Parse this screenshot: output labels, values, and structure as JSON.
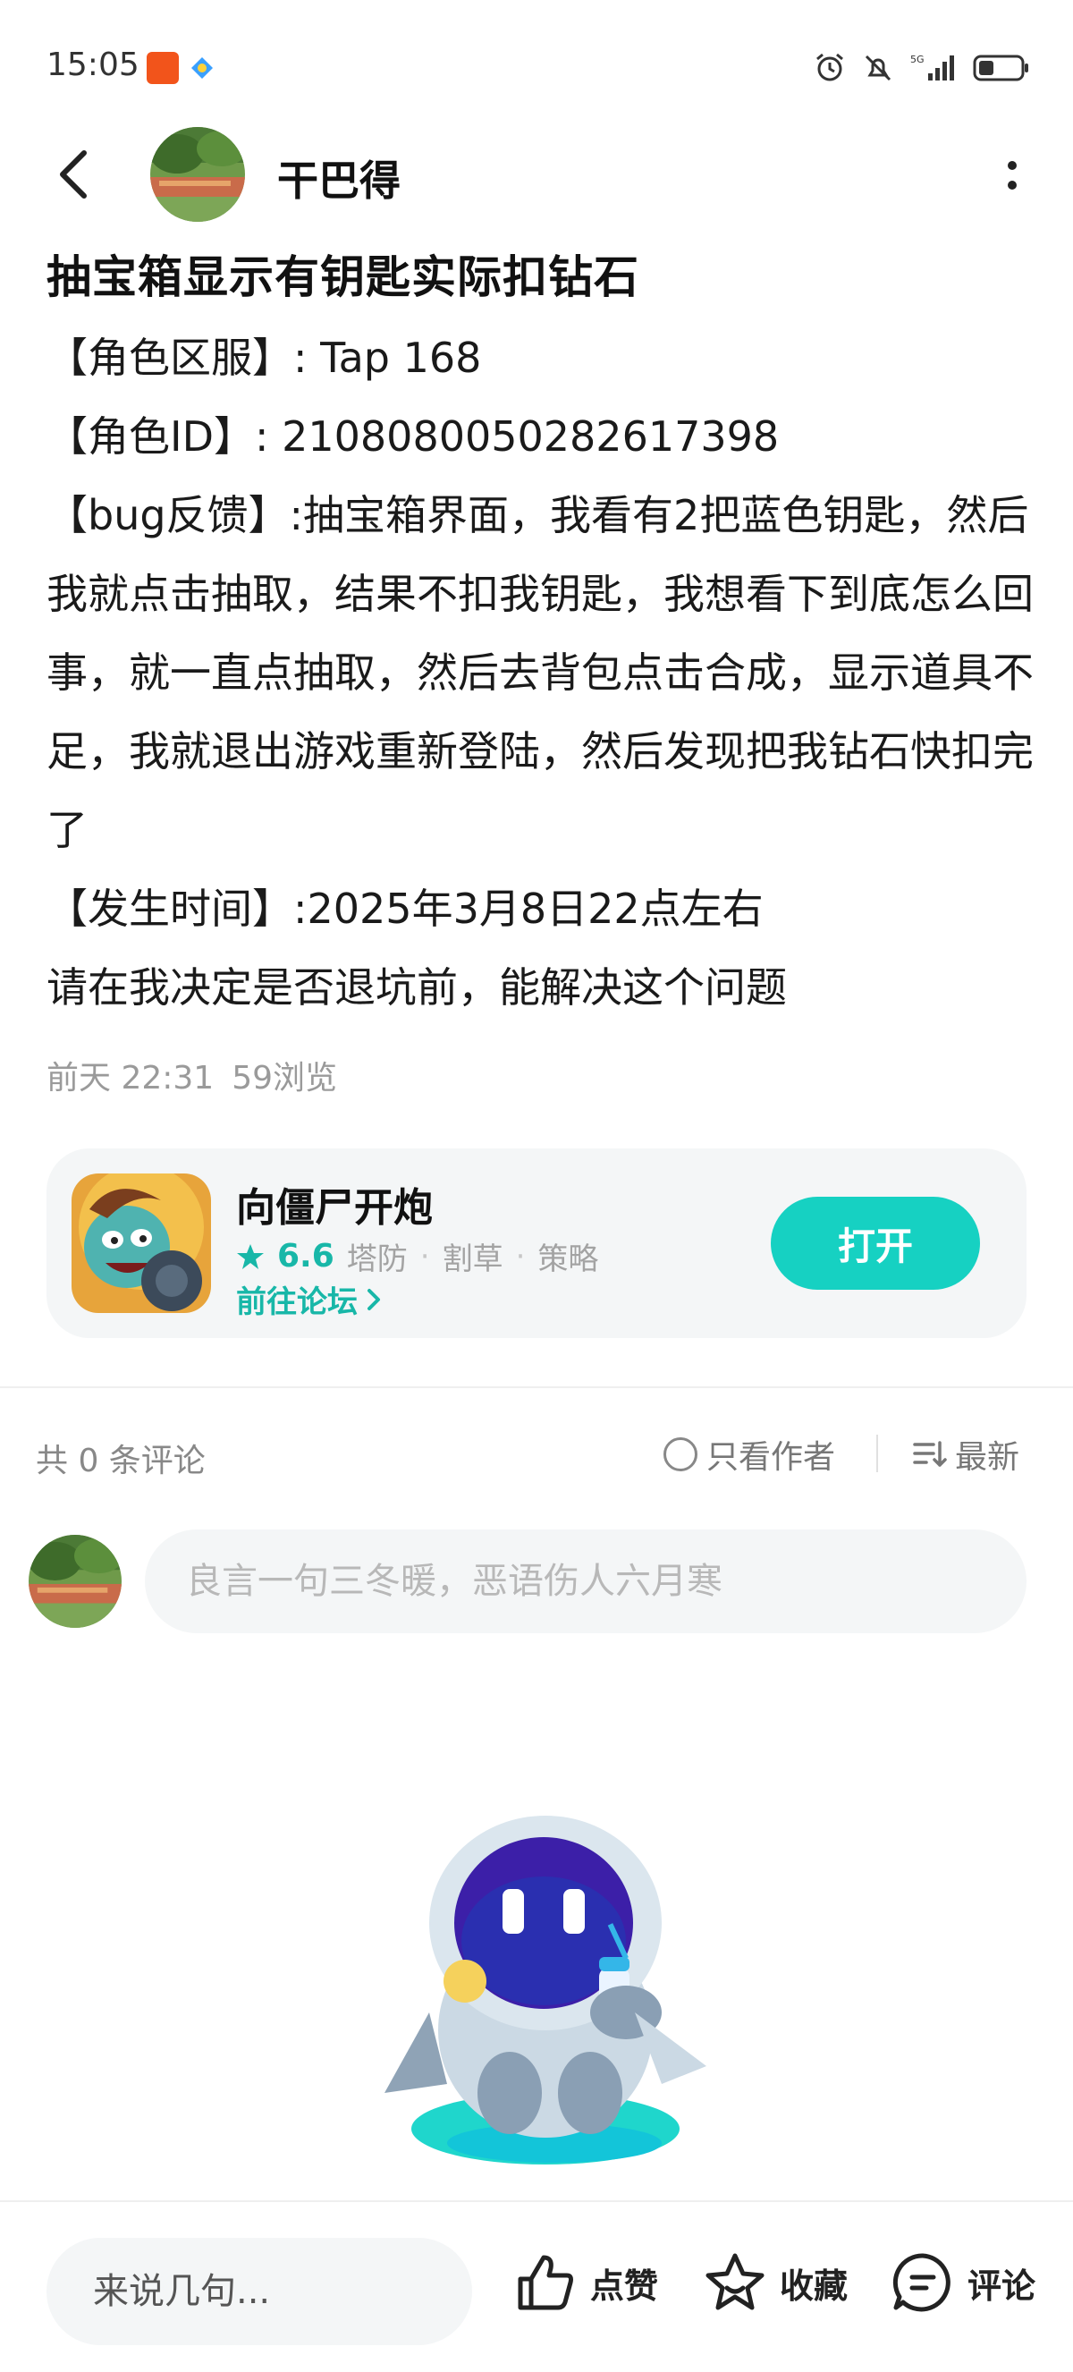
{
  "status_bar": {
    "time": "15:05",
    "network": "5G"
  },
  "header": {
    "author_name": "干巴得"
  },
  "post": {
    "title": "抽宝箱显示有钥匙实际扣钻石",
    "lines": [
      "【角色区服】:  Tap 168",
      "【角色ID】:  2108080050282617398",
      "【bug反馈】:抽宝箱界面，我看有2把蓝色钥匙，然后我就点击抽取，结果不扣我钥匙，我想看下到底怎么回事，就一直点抽取，然后去背包点击合成，显示道具不足，我就退出游戏重新登陆，然后发现把我钻石快扣完了",
      "【发生时间】:2025年3月8日22点左右",
      "请在我决定是否退坑前，能解决这个问题"
    ],
    "time": "前天 22:31",
    "views": "59浏览"
  },
  "game_card": {
    "name": "向僵尸开炮",
    "rating": "6.6",
    "tags": [
      "塔防",
      "割草",
      "策略"
    ],
    "forum_link": "前往论坛",
    "open_label": "打开"
  },
  "comments": {
    "count_label": "共 0 条评论",
    "author_only_label": "只看作者",
    "sort_label": "最新",
    "input_placeholder": "良言一句三冬暖，恶语伤人六月寒"
  },
  "bottom_bar": {
    "say_placeholder": "来说几句...",
    "like_label": "点赞",
    "favorite_label": "收藏",
    "comment_label": "评论"
  },
  "colors": {
    "accent": "#16d1c2",
    "accent_text": "#18b7a8",
    "card_bg": "#f4f6f7"
  }
}
